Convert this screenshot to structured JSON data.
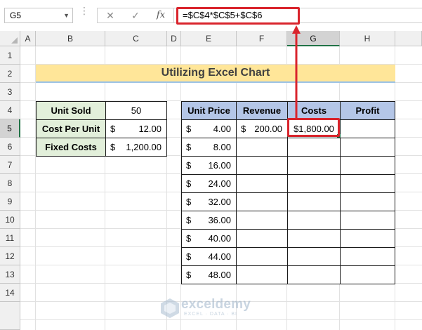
{
  "formula_bar": {
    "name_box": "G5",
    "cancel_icon": "✕",
    "enter_icon": "✓",
    "fx_label": "fx",
    "formula": "=$C$4*$C$5+$C$6"
  },
  "columns": [
    "A",
    "B",
    "C",
    "D",
    "E",
    "F",
    "G",
    "H"
  ],
  "rows": [
    "1",
    "2",
    "3",
    "4",
    "5",
    "6",
    "7",
    "8",
    "9",
    "10",
    "11",
    "12",
    "13",
    "14"
  ],
  "selected_cell": "G5",
  "title": "Utilizing Excel Chart",
  "inputs": {
    "unit_sold_label": "Unit Sold",
    "unit_sold_value": "50",
    "cost_per_unit_label": "Cost Per Unit",
    "cost_per_unit_currency": "$",
    "cost_per_unit_value": "12.00",
    "fixed_costs_label": "Fixed Costs",
    "fixed_costs_currency": "$",
    "fixed_costs_value": "1,200.00"
  },
  "table": {
    "headers": [
      "Unit Price",
      "Revenue",
      "Costs",
      "Profit"
    ],
    "currency": "$",
    "unit_prices": [
      "4.00",
      "8.00",
      "16.00",
      "24.00",
      "32.00",
      "36.00",
      "40.00",
      "44.00",
      "48.00"
    ],
    "revenue_first": "200.00",
    "costs_first": "$1,800.00"
  },
  "watermark": {
    "name": "exceldemy",
    "tagline": "EXCEL · DATA · BI"
  },
  "colors": {
    "title_fill": "#ffe699",
    "label_fill": "#e2efda",
    "header_fill": "#b4c6e7",
    "highlight": "#d9242c",
    "selection": "#217346"
  }
}
